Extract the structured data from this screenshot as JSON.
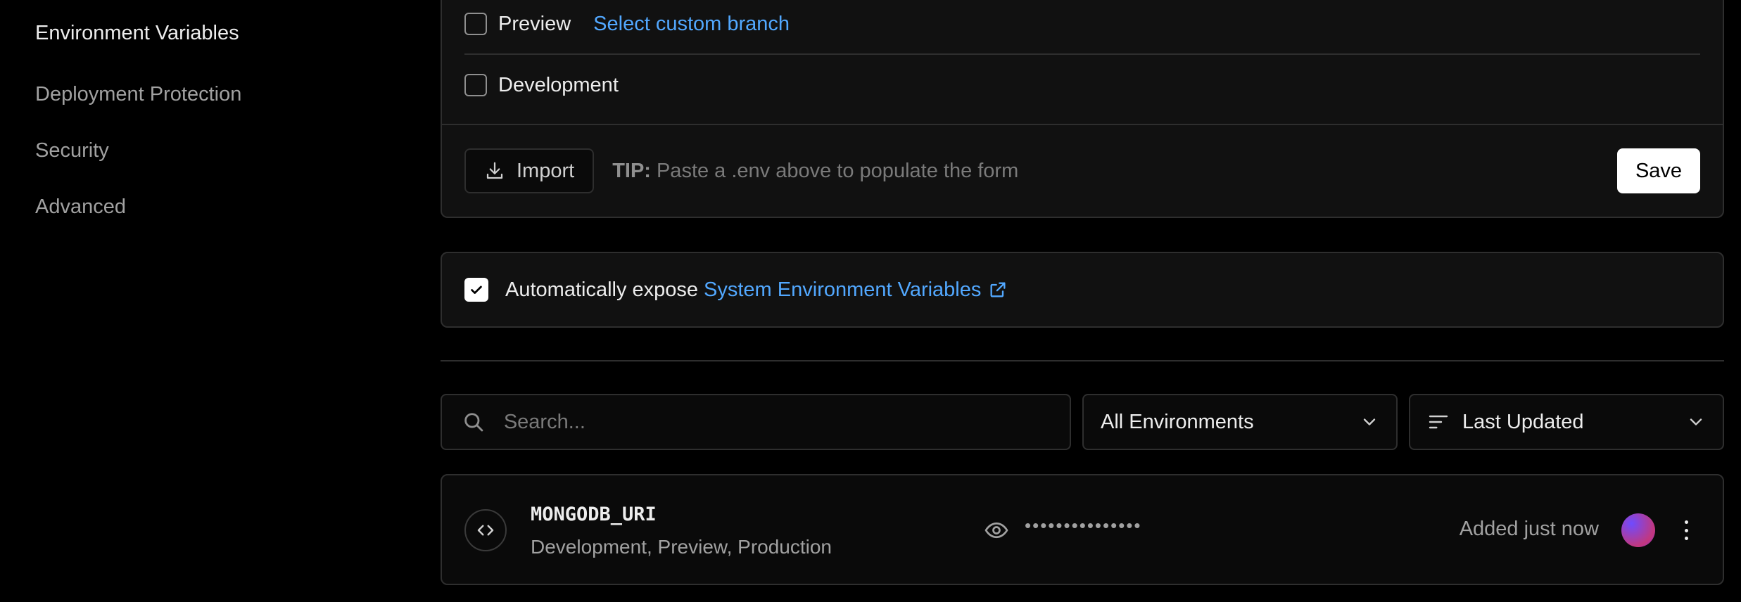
{
  "sidebar": {
    "items": [
      {
        "label": "Environment Variables",
        "active": true
      },
      {
        "label": "Deployment Protection",
        "active": false
      },
      {
        "label": "Security",
        "active": false
      },
      {
        "label": "Advanced",
        "active": false
      }
    ]
  },
  "env_form": {
    "preview_label": "Preview",
    "preview_checked": false,
    "custom_branch_link": "Select custom branch",
    "development_label": "Development",
    "development_checked": false,
    "import_label": "Import",
    "tip_label": "TIP:",
    "tip_text": "Paste a .env above to populate the form",
    "save_label": "Save"
  },
  "expose": {
    "checked": true,
    "text": "Automatically expose",
    "link": "System Environment Variables"
  },
  "filters": {
    "search_placeholder": "Search...",
    "environment_value": "All Environments",
    "sort_value": "Last Updated"
  },
  "variables": [
    {
      "name": "MONGODB_URI",
      "environments": "Development, Preview, Production",
      "masked_value": "•••••••••••••••",
      "added": "Added just now"
    }
  ],
  "colors": {
    "accent_link": "#52a8ff",
    "background": "#000000",
    "panel": "#111111",
    "border": "#2e2e2e"
  }
}
